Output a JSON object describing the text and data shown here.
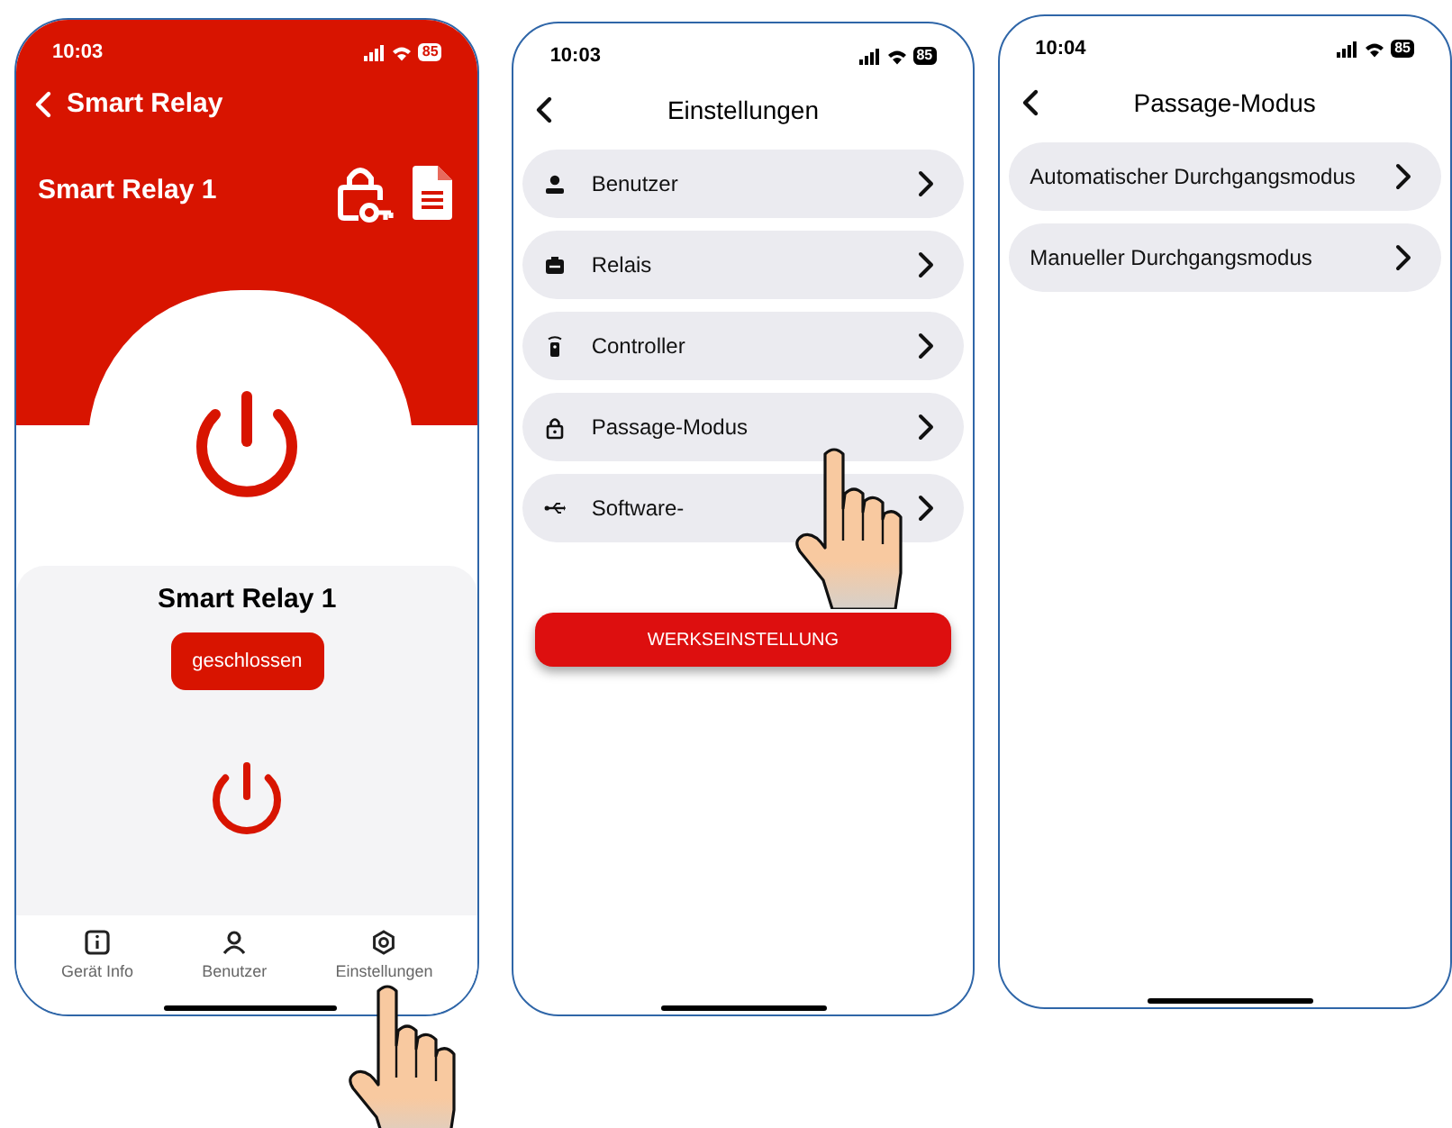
{
  "screens": [
    {
      "status_bar": {
        "time": "10:03",
        "battery": "85"
      },
      "header": {
        "title": "Smart Relay",
        "device_name": "Smart Relay 1"
      },
      "device_card": {
        "name": "Smart Relay 1",
        "state_button": "geschlossen"
      },
      "tab_bar": [
        {
          "label": "Gerät Info"
        },
        {
          "label": "Benutzer"
        },
        {
          "label": "Einstellungen"
        }
      ]
    },
    {
      "status_bar": {
        "time": "10:03",
        "battery": "85"
      },
      "title": "Einstellungen",
      "items": [
        {
          "label": "Benutzer"
        },
        {
          "label": "Relais"
        },
        {
          "label": "Controller"
        },
        {
          "label": "Passage-Modus"
        },
        {
          "label": "Software-"
        }
      ],
      "reset_button": "WERKSEINSTELLUNG"
    },
    {
      "status_bar": {
        "time": "10:04",
        "battery": "85"
      },
      "title": "Passage-Modus",
      "items": [
        {
          "label": "Automatischer Durchgangsmodus"
        },
        {
          "label": "Manueller Durchgangsmodus"
        }
      ]
    }
  ]
}
